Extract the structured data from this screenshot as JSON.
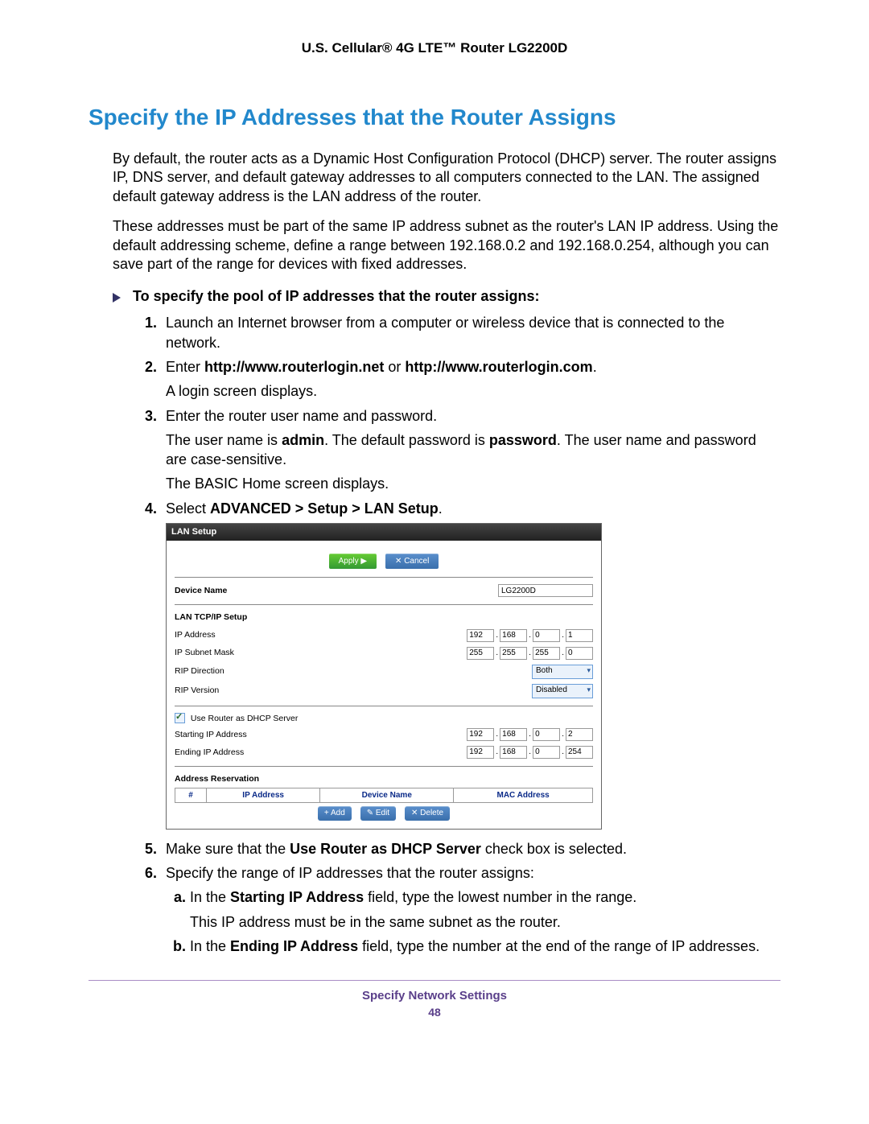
{
  "header": {
    "product": "U.S. Cellular® 4G LTE™ Router LG2200D"
  },
  "title": "Specify the IP Addresses that the Router Assigns",
  "intro1": "By default, the router acts as a Dynamic Host Configuration Protocol (DHCP) server. The router assigns IP, DNS server, and default gateway addresses to all computers connected to the LAN. The assigned default gateway address is the LAN address of the router.",
  "intro2": "These addresses must be part of the same IP address subnet as the router's LAN IP address. Using the default addressing scheme, define a range between 192.168.0.2 and 192.168.0.254, although you can save part of the range for devices with fixed addresses.",
  "procHeading": "To specify the pool of IP addresses that the router assigns:",
  "steps": {
    "s1": "Launch an Internet browser from a computer or wireless device that is connected to the network.",
    "s2a": "Enter ",
    "s2b": "http://www.routerlogin.net",
    "s2c": " or ",
    "s2d": "http://www.routerlogin.com",
    "s2e": ".",
    "s2f": "A login screen displays.",
    "s3": "Enter the router user name and password.",
    "s3a1": "The user name is ",
    "s3a2": "admin",
    "s3a3": ". The default password is ",
    "s3a4": "password",
    "s3a5": ". The user name and password are case-sensitive.",
    "s3b": "The BASIC Home screen displays.",
    "s4a": "Select ",
    "s4b": "ADVANCED > Setup > LAN Setup",
    "s4c": ".",
    "s5a": "Make sure that the ",
    "s5b": "Use Router as DHCP Server",
    "s5c": " check box is selected.",
    "s6": "Specify the range of IP addresses that the router assigns:",
    "s6a1": "In the ",
    "s6a2": "Starting IP Address",
    "s6a3": " field, type the lowest number in the range.",
    "s6a4": "This IP address must be in the same subnet as the router.",
    "s6b1": "In the ",
    "s6b2": "Ending IP Address",
    "s6b3": " field, type the number at the end of the range of IP addresses."
  },
  "lan": {
    "title": "LAN Setup",
    "apply": "Apply ▶",
    "cancel": "✕ Cancel",
    "deviceNameLabel": "Device Name",
    "deviceName": "LG2200D",
    "tcpipLabel": "LAN TCP/IP Setup",
    "ipAddressLabel": "IP Address",
    "ip": [
      "192",
      "168",
      "0",
      "1"
    ],
    "subnetLabel": "IP Subnet Mask",
    "subnet": [
      "255",
      "255",
      "255",
      "0"
    ],
    "ripDirLabel": "RIP Direction",
    "ripDir": "Both",
    "ripVerLabel": "RIP Version",
    "ripVer": "Disabled",
    "dhcpLabel": "Use Router as DHCP Server",
    "startIPLabel": "Starting IP Address",
    "startIP": [
      "192",
      "168",
      "0",
      "2"
    ],
    "endIPLabel": "Ending IP Address",
    "endIP": [
      "192",
      "168",
      "0",
      "254"
    ],
    "arLabel": "Address Reservation",
    "arCols": {
      "num": "#",
      "ip": "IP Address",
      "dev": "Device Name",
      "mac": "MAC Address"
    },
    "add": "+ Add",
    "edit": "✎ Edit",
    "del": "✕ Delete"
  },
  "footer": {
    "section": "Specify Network Settings",
    "page": "48"
  }
}
